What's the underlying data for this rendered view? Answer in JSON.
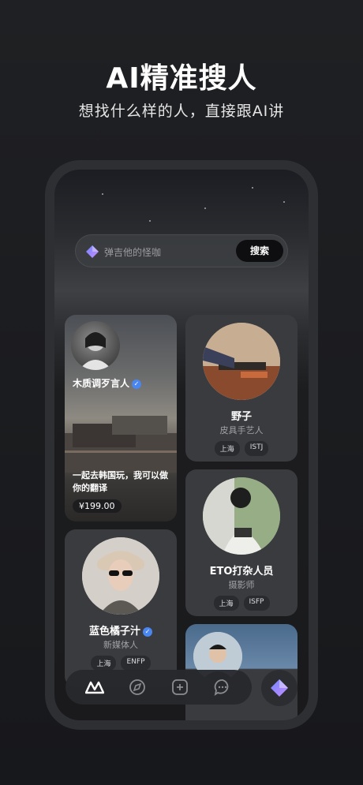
{
  "headline": "AI精准搜人",
  "subline": "想找什么样的人，直接跟AI讲",
  "search": {
    "placeholder": "弹吉他的怪咖",
    "button": "搜索"
  },
  "cards": {
    "featured": {
      "name": "木质调歹言人",
      "description": "一起去韩国玩，我可以做你的翻译",
      "price": "¥199.00"
    },
    "person1": {
      "name": "野子",
      "role": "皮具手艺人",
      "tags": [
        "上海",
        "ISTJ"
      ]
    },
    "person2": {
      "name": "ETO打杂人员",
      "role": "摄影师",
      "tags": [
        "上海",
        "ISFP"
      ]
    },
    "person3": {
      "name": "蓝色橘子汁",
      "role": "新媒体人",
      "tags": [
        "上海",
        "ENFP"
      ]
    }
  },
  "tabbar": {
    "items": [
      "home-icon",
      "compass-icon",
      "add-icon",
      "chat-icon"
    ],
    "fab": "ai-gem-icon"
  },
  "colors": {
    "accent_gradient": [
      "#7a8cff",
      "#c68bff"
    ],
    "verify": "#4a86f0"
  }
}
